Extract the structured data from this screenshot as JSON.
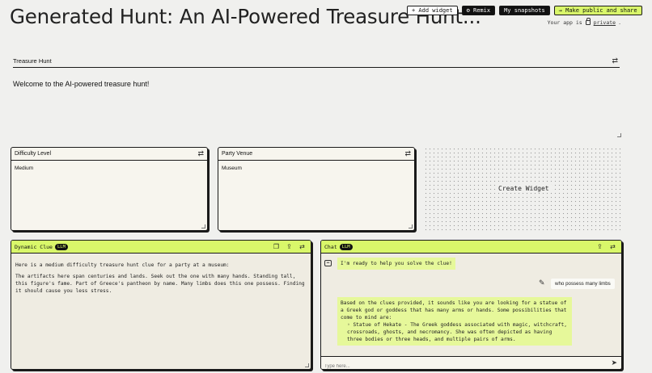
{
  "header": {
    "title": "Generated Hunt: An AI-Powered Treasure Hunt...",
    "buttons": {
      "add_widget": "+ Add widget",
      "remix": "⚙ Remix",
      "snapshots": "My snapshots",
      "share": "→ Make public and share"
    },
    "visibility_prefix": "Your app is",
    "visibility_value": "private",
    "visibility_suffix": "."
  },
  "treasure_hunt": {
    "title": "Treasure Hunt",
    "body": "Welcome to the AI-powered treasure hunt!"
  },
  "difficulty": {
    "title": "Difficulty Level",
    "value": "Medium"
  },
  "venue": {
    "title": "Party Venue",
    "value": "Museum"
  },
  "create_widget": {
    "label": "Create Widget"
  },
  "clue": {
    "title": "Dynamic Clue",
    "badge": "LLM",
    "intro": "Here is a medium difficulty treasure hunt clue for a party at a museum:",
    "text": "The artifacts here span centuries and lands. Seek out the one with many hands. Standing tall, this figure's fame. Part of Greece's pantheon by name. Many limbs does this one possess. Finding it should cause you less stress."
  },
  "chat": {
    "title": "Chat",
    "badge": "LLM",
    "msg1": "I'm ready to help you solve the clue!",
    "user_msg": "who possess many limbs",
    "reply_intro": "Based on the clues provided, it sounds like you are looking for a statue of a Greek god or goddess that has many arms or hands. Some possibilities that come to mind are:",
    "reply_item": "Statue of Hekate - The Greek goddess associated with magic, witchcraft, crossroads, ghosts, and necromancy. She was often depicted as having three bodies or three heads, and multiple pairs of arms.",
    "input_placeholder": "Type here..."
  }
}
